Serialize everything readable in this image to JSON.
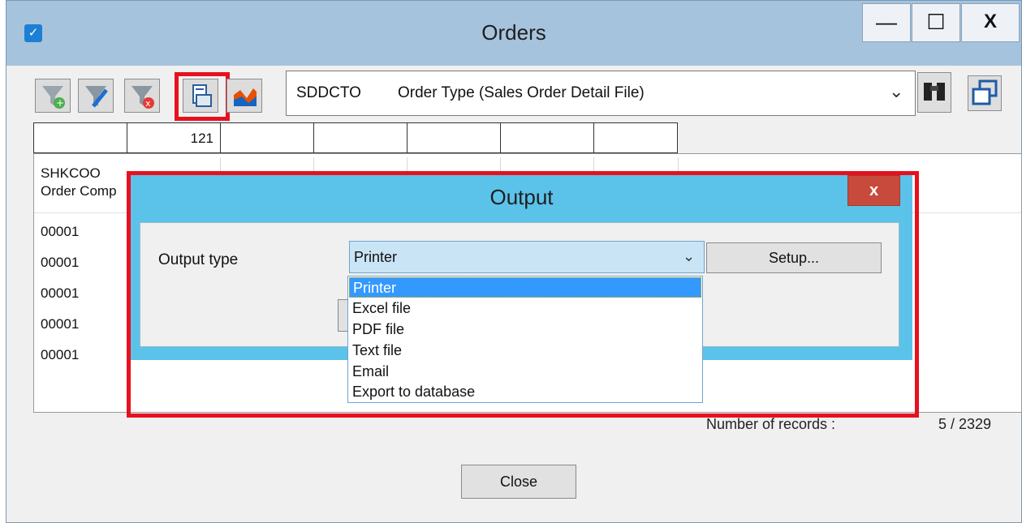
{
  "window": {
    "title": "Orders",
    "min_label": "—",
    "max_label": "☐",
    "close_label": "X"
  },
  "toolbar": {
    "combo_code": "SDDCTO",
    "combo_desc": "Order Type (Sales Order Detail File)",
    "combo_arrow": "⌄"
  },
  "filter_row": [
    "",
    "121",
    "",
    "",
    "",
    "",
    ""
  ],
  "grid": {
    "header_col1_line1": "SHKCOO",
    "header_col1_line2": "Order Comp",
    "rows": [
      "00001",
      "00001",
      "00001",
      "00001",
      "00001"
    ]
  },
  "footer": {
    "records_label": "Number of records :",
    "records_value": "5 / 2329",
    "close_label": "Close"
  },
  "dialog": {
    "title": "Output",
    "close_label": "x",
    "output_type_label": "Output type",
    "selected": "Printer",
    "setup_label": "Setup...",
    "options": [
      "Printer",
      "Excel file",
      "PDF file",
      "Text file",
      "Email",
      "Export to database"
    ]
  },
  "colors": {
    "titlebar": "#a6c3dd",
    "dialog": "#5bc3ea",
    "highlight": "#e8101e",
    "selection": "#3399ff"
  }
}
